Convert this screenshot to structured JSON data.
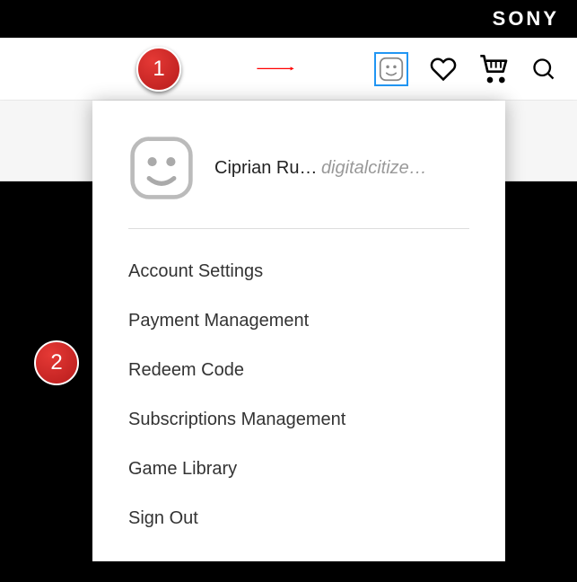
{
  "brand": {
    "logo": "SONY"
  },
  "nav": {
    "icons": {
      "avatar": "avatar-icon",
      "wishlist": "heart-icon",
      "cart": "cart-icon",
      "search": "search-icon"
    }
  },
  "user": {
    "name": "Ciprian Ru…",
    "handle": "digitalcitize…"
  },
  "menu": [
    "Account Settings",
    "Payment Management",
    "Redeem Code",
    "Subscriptions Management",
    "Game Library",
    "Sign Out"
  ],
  "annotations": {
    "badge1": "1",
    "badge2": "2"
  }
}
